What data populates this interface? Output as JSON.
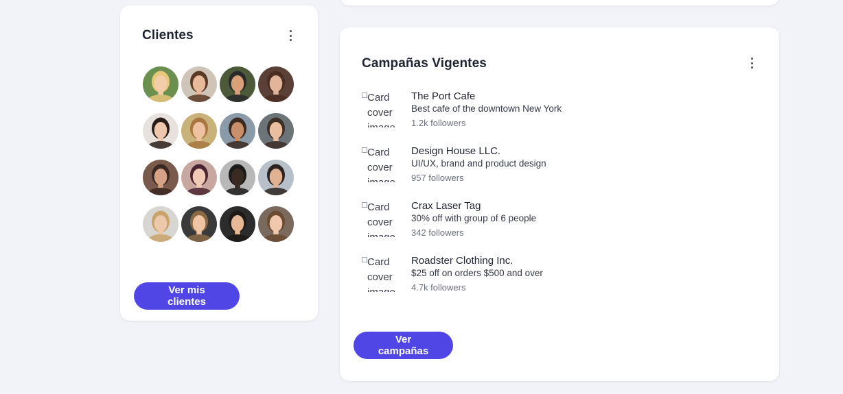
{
  "clients": {
    "title": "Clientes",
    "button_label": "Ver mis clientes",
    "avatars": [
      {
        "bg": "#6b8f4e",
        "skin": "#f3cda9",
        "hair": "#e7c77a"
      },
      {
        "bg": "#cfc4b8",
        "skin": "#e8b99a",
        "hair": "#5a3a25"
      },
      {
        "bg": "#4c5a3a",
        "skin": "#d9a07a",
        "hair": "#2a2a2a"
      },
      {
        "bg": "#5b4038",
        "skin": "#e2b59a",
        "hair": "#4a2e22"
      },
      {
        "bg": "#e8e2df",
        "skin": "#f0c7ad",
        "hair": "#2b1e1a"
      },
      {
        "bg": "#c9b27a",
        "skin": "#eec2a0",
        "hair": "#a8773f"
      },
      {
        "bg": "#8b9aa8",
        "skin": "#c98e6a",
        "hair": "#3a2a20"
      },
      {
        "bg": "#6d7478",
        "skin": "#e9bf9f",
        "hair": "#3c2f26"
      },
      {
        "bg": "#7a5a4c",
        "skin": "#d7a387",
        "hair": "#3a2822"
      },
      {
        "bg": "#c7a7a0",
        "skin": "#f1cab6",
        "hair": "#4a2430"
      },
      {
        "bg": "#b8b8b8",
        "skin": "#3a2a22",
        "hair": "#1a1a1a"
      },
      {
        "bg": "#b7c0c8",
        "skin": "#e0b193",
        "hair": "#2a2320"
      },
      {
        "bg": "#d8d6d2",
        "skin": "#eec8aa",
        "hair": "#c9a36a"
      },
      {
        "bg": "#3a3a3a",
        "skin": "#efc4a2",
        "hair": "#8a6a45"
      },
      {
        "bg": "#2c2c2c",
        "skin": "#e6b895",
        "hair": "#1f1a17"
      },
      {
        "bg": "#7a6a5e",
        "skin": "#f0c8ad",
        "hair": "#6b4a30"
      }
    ]
  },
  "campaigns": {
    "title": "Campañas Vigentes",
    "button_label": "Ver campañas",
    "image_alt": "Card cover image",
    "items": [
      {
        "name": "The Port Cafe",
        "description": "Best cafe of the downtown New York",
        "followers": "1.2k followers"
      },
      {
        "name": "Design House LLC.",
        "description": "UI/UX, brand and product design",
        "followers": "957 followers"
      },
      {
        "name": "Crax Laser Tag",
        "description": "30% off with group of 6 people",
        "followers": "342 followers"
      },
      {
        "name": "Roadster Clothing Inc.",
        "description": "$25 off on orders $500 and over",
        "followers": "4.7k followers"
      }
    ]
  },
  "colors": {
    "accent": "#4f46e5",
    "background": "#f1f3f8"
  }
}
